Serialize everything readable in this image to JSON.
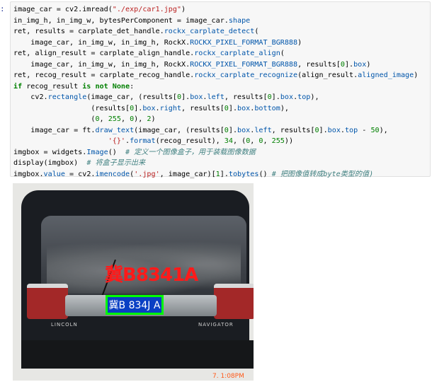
{
  "notebook": {
    "prompt": ":"
  },
  "code_lines": [
    [
      {
        "t": "image_car = cv2.imread("
      },
      {
        "t": "\"./exp/car1.jpg\"",
        "c": "str"
      },
      {
        "t": ")"
      }
    ],
    [
      {
        "t": "in_img_h, in_img_w, bytesPerComponent = image_car."
      },
      {
        "t": "shape",
        "c": "attr"
      }
    ],
    [
      {
        "t": "ret, results = carplate_det_handle."
      },
      {
        "t": "rockx_carplate_detect",
        "c": "attr"
      },
      {
        "t": "("
      }
    ],
    [
      {
        "t": "    image_car, in_img_w, in_img_h, RockX."
      },
      {
        "t": "ROCKX_PIXEL_FORMAT_BGR888",
        "c": "attr"
      },
      {
        "t": ")"
      }
    ],
    [
      {
        "t": "ret, align_result = carplate_align_handle."
      },
      {
        "t": "rockx_carplate_align",
        "c": "attr"
      },
      {
        "t": "("
      }
    ],
    [
      {
        "t": "    image_car, in_img_w, in_img_h, RockX."
      },
      {
        "t": "ROCKX_PIXEL_FORMAT_BGR888",
        "c": "attr"
      },
      {
        "t": ", results["
      },
      {
        "t": "0",
        "c": "num"
      },
      {
        "t": "]."
      },
      {
        "t": "box",
        "c": "attr"
      },
      {
        "t": ")"
      }
    ],
    [
      {
        "t": "ret, recog_result = carplate_recog_handle."
      },
      {
        "t": "rockx_carplate_recognize",
        "c": "attr"
      },
      {
        "t": "(align_result."
      },
      {
        "t": "aligned_image",
        "c": "attr"
      },
      {
        "t": ")"
      }
    ],
    [
      {
        "t": "if",
        "c": "kw"
      },
      {
        "t": " recog_result "
      },
      {
        "t": "is not None",
        "c": "kw"
      },
      {
        "t": ":"
      }
    ],
    [
      {
        "t": "    cv2."
      },
      {
        "t": "rectangle",
        "c": "attr"
      },
      {
        "t": "(image_car, (results["
      },
      {
        "t": "0",
        "c": "num"
      },
      {
        "t": "]."
      },
      {
        "t": "box",
        "c": "attr"
      },
      {
        "t": "."
      },
      {
        "t": "left",
        "c": "attr"
      },
      {
        "t": ", results["
      },
      {
        "t": "0",
        "c": "num"
      },
      {
        "t": "]."
      },
      {
        "t": "box",
        "c": "attr"
      },
      {
        "t": "."
      },
      {
        "t": "top",
        "c": "attr"
      },
      {
        "t": "),"
      }
    ],
    [
      {
        "t": "                  (results["
      },
      {
        "t": "0",
        "c": "num"
      },
      {
        "t": "]."
      },
      {
        "t": "box",
        "c": "attr"
      },
      {
        "t": "."
      },
      {
        "t": "right",
        "c": "attr"
      },
      {
        "t": ", results["
      },
      {
        "t": "0",
        "c": "num"
      },
      {
        "t": "]."
      },
      {
        "t": "box",
        "c": "attr"
      },
      {
        "t": "."
      },
      {
        "t": "bottom",
        "c": "attr"
      },
      {
        "t": "),"
      }
    ],
    [
      {
        "t": "                  ("
      },
      {
        "t": "0",
        "c": "num"
      },
      {
        "t": ", "
      },
      {
        "t": "255",
        "c": "num"
      },
      {
        "t": ", "
      },
      {
        "t": "0",
        "c": "num"
      },
      {
        "t": "), "
      },
      {
        "t": "2",
        "c": "num"
      },
      {
        "t": ")"
      }
    ],
    [
      {
        "t": "    image_car = ft."
      },
      {
        "t": "draw_text",
        "c": "attr"
      },
      {
        "t": "(image_car, (results["
      },
      {
        "t": "0",
        "c": "num"
      },
      {
        "t": "]."
      },
      {
        "t": "box",
        "c": "attr"
      },
      {
        "t": "."
      },
      {
        "t": "left",
        "c": "attr"
      },
      {
        "t": ", results["
      },
      {
        "t": "0",
        "c": "num"
      },
      {
        "t": "]."
      },
      {
        "t": "box",
        "c": "attr"
      },
      {
        "t": "."
      },
      {
        "t": "top",
        "c": "attr"
      },
      {
        "t": " - "
      },
      {
        "t": "50",
        "c": "num"
      },
      {
        "t": "),"
      }
    ],
    [
      {
        "t": "                      "
      },
      {
        "t": "'{}'",
        "c": "str"
      },
      {
        "t": "."
      },
      {
        "t": "format",
        "c": "attr"
      },
      {
        "t": "(recog_result), "
      },
      {
        "t": "34",
        "c": "num"
      },
      {
        "t": ", ("
      },
      {
        "t": "0",
        "c": "num"
      },
      {
        "t": ", "
      },
      {
        "t": "0",
        "c": "num"
      },
      {
        "t": ", "
      },
      {
        "t": "255",
        "c": "num"
      },
      {
        "t": "))"
      }
    ],
    [
      {
        "t": "imgbox = widgets."
      },
      {
        "t": "Image",
        "c": "attr"
      },
      {
        "t": "()  "
      },
      {
        "t": "# 定义一个图像盒子，用于装载图像数据",
        "c": "cmt"
      }
    ],
    [
      {
        "t": "display(imgbox)  "
      },
      {
        "t": "# 将盒子显示出来",
        "c": "cmt"
      }
    ],
    [
      {
        "t": "imgbox."
      },
      {
        "t": "value",
        "c": "attr"
      },
      {
        "t": " = cv2."
      },
      {
        "t": "imencode",
        "c": "attr"
      },
      {
        "t": "("
      },
      {
        "t": "'.jpg'",
        "c": "str"
      },
      {
        "t": ", image_car)["
      },
      {
        "t": "1",
        "c": "num"
      },
      {
        "t": "]."
      },
      {
        "t": "tobytes",
        "c": "attr"
      },
      {
        "t": "() "
      },
      {
        "t": "# 把图像值转成byte类型的值)",
        "c": "cmt"
      }
    ]
  ],
  "output_image": {
    "recognized_text": "冀B8341A",
    "plate_text": "冀B 834J A",
    "badge_left": "LINCOLN",
    "badge_right": "NAVIGATOR",
    "timestamp": "7. 1:08PM",
    "colors": {
      "overlay_text": "#ff1a1a",
      "box": "#00ff00",
      "plate": "#0a3fc4"
    }
  }
}
